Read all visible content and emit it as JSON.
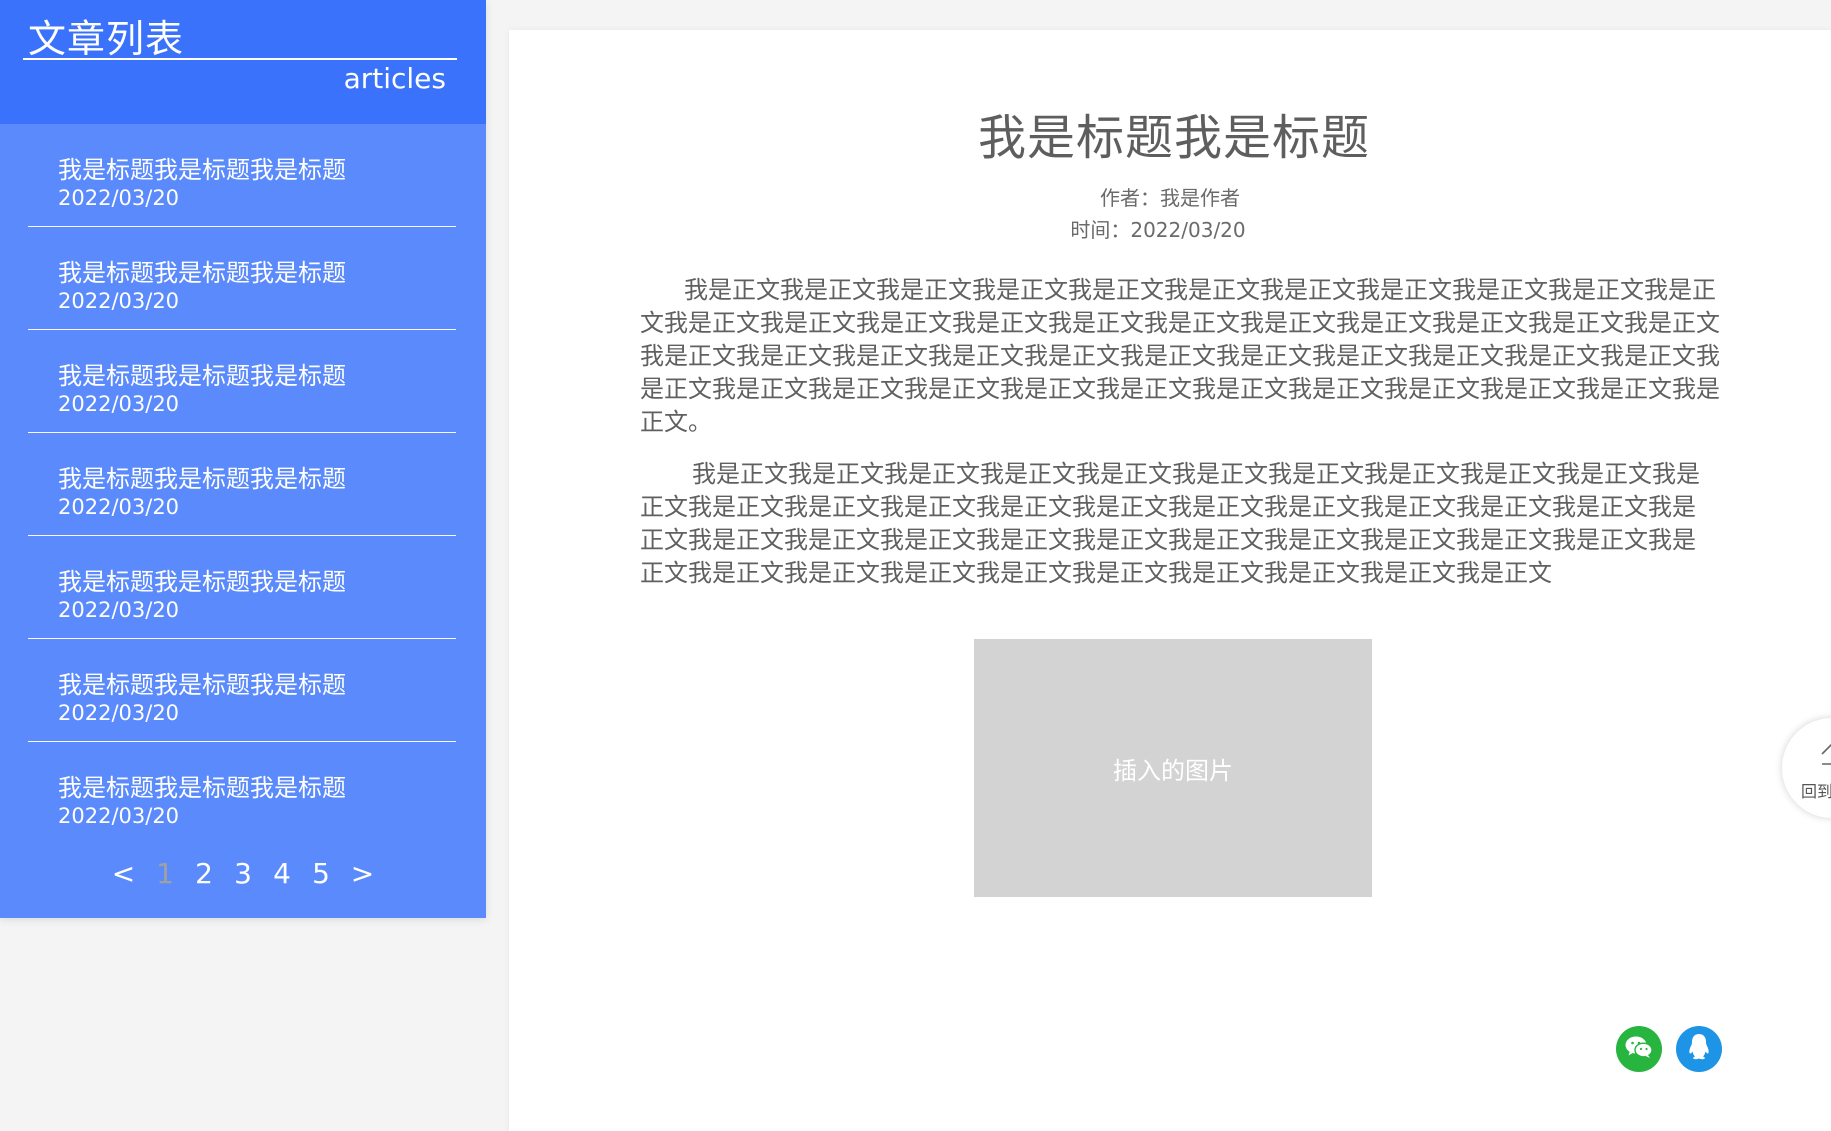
{
  "sidebar": {
    "title": "文章列表",
    "subtitle": "articles",
    "items": [
      {
        "title": "我是标题我是标题我是标题",
        "date": "2022/03/20"
      },
      {
        "title": "我是标题我是标题我是标题",
        "date": "2022/03/20"
      },
      {
        "title": "我是标题我是标题我是标题",
        "date": "2022/03/20"
      },
      {
        "title": "我是标题我是标题我是标题",
        "date": "2022/03/20"
      },
      {
        "title": "我是标题我是标题我是标题",
        "date": "2022/03/20"
      },
      {
        "title": "我是标题我是标题我是标题",
        "date": "2022/03/20"
      },
      {
        "title": "我是标题我是标题我是标题",
        "date": "2022/03/20"
      }
    ],
    "pagination": {
      "prev": "<",
      "pages": [
        "1",
        "2",
        "3",
        "4",
        "5"
      ],
      "current": "1",
      "next": ">"
    }
  },
  "article": {
    "title": "我是标题我是标题",
    "author": "作者：我是作者",
    "time": "时间：2022/03/20",
    "paragraphs": [
      "我是正文我是正文我是正文我是正文我是正文我是正文我是正文我是正文我是正文我是正文我是正文我是正文我是正文我是正文我是正文我是正文我是正文我是正文我是正文我是正文我是正文我是正文我是正文我是正文我是正文我是正文我是正文我是正文我是正文我是正文我是正文我是正文我是正文我是正文我是正文我是正文我是正文我是正文我是正文我是正文我是正文我是正文我是正文我是正文我是正文。",
      "我是正文我是正文我是正文我是正文我是正文我是正文我是正文我是正文我是正文我是正文我是正文我是正文我是正文我是正文我是正文我是正文我是正文我是正文我是正文我是正文我是正文我是正文我是正文我是正文我是正文我是正文我是正文我是正文我是正文我是正文我是正文我是正文我是正文我是正文我是正文我是正文我是正文我是正文我是正文我是正文我是正文我是正文"
    ],
    "image_caption": "插入的图片"
  },
  "share": {
    "icons": [
      "wechat-icon",
      "qq-icon"
    ],
    "wechat_color": "#27b43f",
    "qq_color": "#1e94e6"
  },
  "back_to_top": {
    "label": "回到顶部",
    "icon": "chevron-up-icon"
  },
  "colors": {
    "sidebar_header": "#3b72fb",
    "sidebar_body": "#5a8afc",
    "placeholder": "#d3d3d3"
  }
}
